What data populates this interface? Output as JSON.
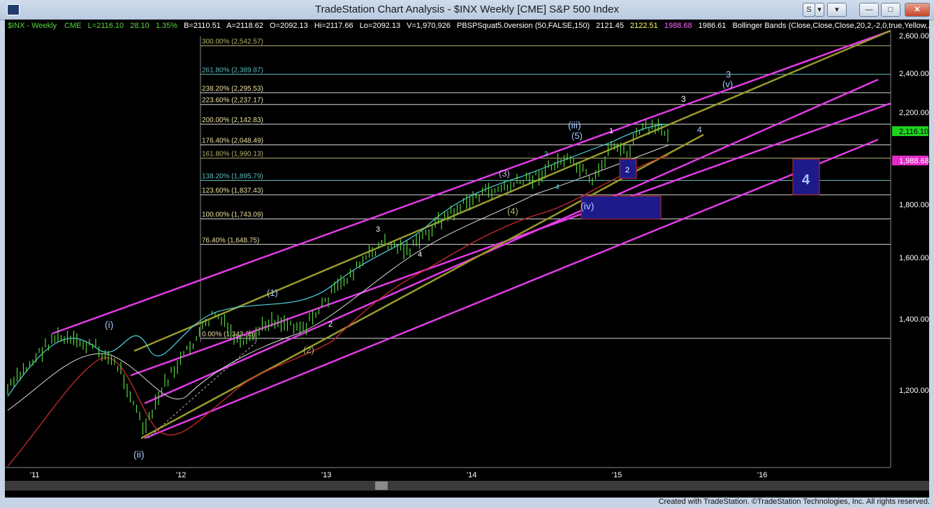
{
  "window": {
    "title": "TradeStation Chart Analysis - $INX Weekly [CME] S&P 500 Index",
    "buttons": [
      "S",
      "▾",
      "▾"
    ],
    "controls": {
      "minimize": "—",
      "maximize": "□",
      "close": "✕"
    }
  },
  "header": {
    "symbol": "$INX - Weekly",
    "exchange": "CME",
    "last": "L=2116.10",
    "change": "28.10",
    "change_pct": "1.35%",
    "bid": "B=2110.51",
    "ask": "A=2118.62",
    "open": "O=2092.13",
    "high": "Hi=2117.66",
    "low": "Lo=2092.13",
    "volume": "V=1,970,926",
    "study": "PBSPSquat5.0version (50,FALSE,150)",
    "study_v1": "2121.45",
    "study_v2": "2122.51",
    "study_v3": "1988.68",
    "study_v4": "1986.61",
    "bollinger": "Bollinger Bands (Close,Close,Close,20,2,-2,0,true,Yellow,..."
  },
  "colors": {
    "background": "#000000",
    "magenta": "#e33be6",
    "olive": "#9a9a2a",
    "cyan": "#4fd3e0",
    "green_bars": "#57d63c",
    "red_line": "#c0282a",
    "wave_label": "#a9c6ff",
    "fib_text": "#e8e0a0"
  },
  "fib_levels": [
    {
      "label": "300.00% (2,542.57)",
      "value": 2542.57,
      "color": "#b5b26a"
    },
    {
      "label": "261.80% (2,389.87)",
      "value": 2389.87,
      "color": "#5fbaba"
    },
    {
      "label": "238.20% (2,295.53)",
      "value": 2295.53,
      "color": "#dddddd"
    },
    {
      "label": "223.60% (2,237.17)",
      "value": 2237.17,
      "color": "#dddddd"
    },
    {
      "label": "200.00% (2,142.83)",
      "value": 2142.83,
      "color": "#dddddd"
    },
    {
      "label": "176.40% (2,048.49)",
      "value": 2048.49,
      "color": "#dddddd"
    },
    {
      "label": "161.80% (1,990.13)",
      "value": 1990.13,
      "color": "#b5b26a"
    },
    {
      "label": "138.20% (1,895.79)",
      "value": 1895.79,
      "color": "#5fbaba"
    },
    {
      "label": "123.60% (1,837.43)",
      "value": 1837.43,
      "color": "#dddddd"
    },
    {
      "label": "100.00% (1,743.09)",
      "value": 1743.09,
      "color": "#dddddd"
    },
    {
      "label": "76.40% (1,648.75)",
      "value": 1648.75,
      "color": "#dddddd"
    },
    {
      "label": "0.00% (1,343.35)",
      "value": 1343.35,
      "color": "#dddddd"
    }
  ],
  "y_axis": {
    "ticks": [
      {
        "label": "2,600.00",
        "value": 2600
      },
      {
        "label": "2,400.00",
        "value": 2400
      },
      {
        "label": "2,200.00",
        "value": 2200
      },
      {
        "label": "1,800.00",
        "value": 1800
      },
      {
        "label": "1,600.00",
        "value": 1600
      },
      {
        "label": "1,400.00",
        "value": 1400
      },
      {
        "label": "1,200.00",
        "value": 1200
      }
    ],
    "last_price_label": "2,116.10",
    "indicator_label": "1,988.68"
  },
  "x_axis": {
    "ticks": [
      "'11",
      "'12",
      "'13",
      "'14",
      "'15",
      "'16"
    ]
  },
  "wave_labels": [
    {
      "text": "(i)",
      "wave": "i"
    },
    {
      "text": "(ii)",
      "wave": "ii"
    },
    {
      "text": "(1)",
      "wave": "1"
    },
    {
      "text": "(2)",
      "wave": "2"
    },
    {
      "text": "2",
      "wave": "2a"
    },
    {
      "text": "3",
      "wave": "3a"
    },
    {
      "text": "4",
      "wave": "4a"
    },
    {
      "text": "(3)",
      "wave": "3"
    },
    {
      "text": "(4)",
      "wave": "4"
    },
    {
      "text": "(5)",
      "wave": "5"
    },
    {
      "text": "(iii)",
      "wave": "iii"
    },
    {
      "text": "(iv)",
      "wave": "iv"
    },
    {
      "text": "1",
      "wave": "1b"
    },
    {
      "text": "2",
      "wave": "2b"
    },
    {
      "text": "3",
      "wave": "3b"
    },
    {
      "text": "4",
      "wave": "4b"
    },
    {
      "text": "3",
      "wave": "3c"
    },
    {
      "text": "4",
      "wave": "4c"
    },
    {
      "text": "3",
      "wave": "3d"
    },
    {
      "text": "(v)",
      "wave": "v"
    },
    {
      "text": "4",
      "wave": "big4"
    }
  ],
  "status_bar": {
    "credit": "Created with TradeStation. ©TradeStation Technologies, Inc. All rights reserved."
  }
}
